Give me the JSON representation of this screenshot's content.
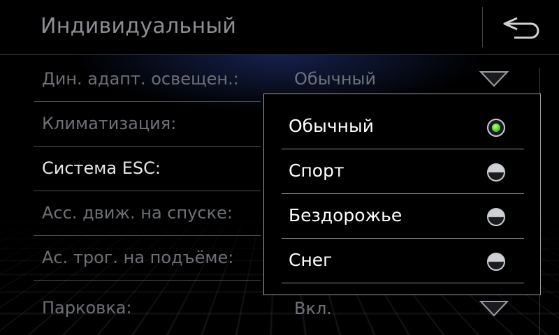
{
  "header": {
    "title": "Индивидуальный",
    "back_icon": "back-arrow-icon"
  },
  "settings": [
    {
      "label": "Дин. адапт. освещен.:",
      "value": "Обычный",
      "active": false
    },
    {
      "label": "Климатизация:",
      "value": "",
      "active": false
    },
    {
      "label": "Система ESC:",
      "value": "",
      "active": true
    },
    {
      "label": "Асс. движ. на спуске:",
      "value": "",
      "active": false
    },
    {
      "label": "Ас. трог. на подъёме:",
      "value": "",
      "active": false
    },
    {
      "label": "Парковка:",
      "value": "Вкл.",
      "active": false
    }
  ],
  "dropdown": {
    "selected": "Обычный",
    "options": [
      {
        "label": "Обычный",
        "selected": true
      },
      {
        "label": "Спорт",
        "selected": false
      },
      {
        "label": "Бездорожье",
        "selected": false
      },
      {
        "label": "Снег",
        "selected": false
      }
    ]
  },
  "colors": {
    "accent_selected": "#44c322",
    "active_text": "#e6e6e6",
    "inactive_text": "#6d7076"
  }
}
